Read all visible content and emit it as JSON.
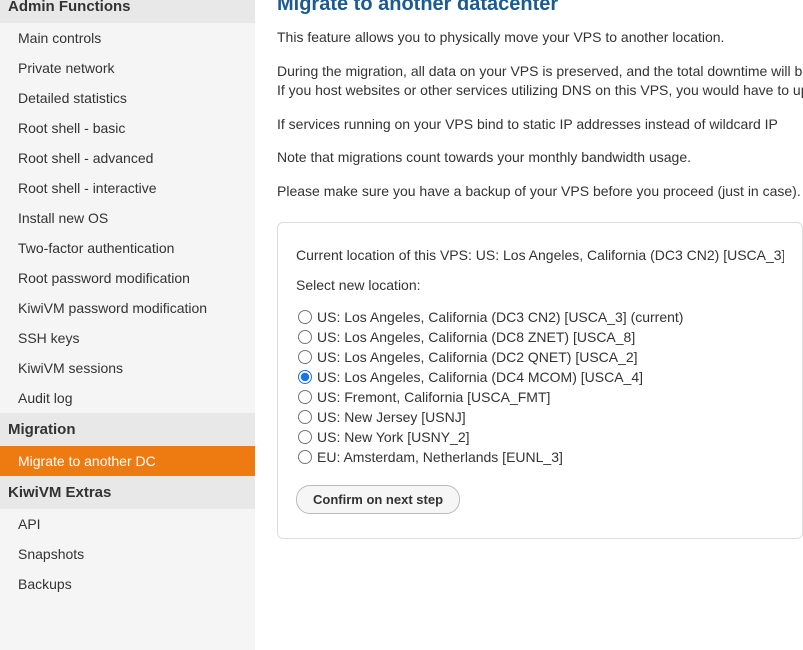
{
  "sidebar": {
    "headerTop": "Admin Functions",
    "items_top": [
      {
        "label": "Main controls"
      },
      {
        "label": "Private network"
      },
      {
        "label": "Detailed statistics"
      },
      {
        "label": "Root shell - basic"
      },
      {
        "label": "Root shell - advanced"
      },
      {
        "label": "Root shell - interactive"
      },
      {
        "label": "Install new OS"
      },
      {
        "label": "Two-factor authentication"
      },
      {
        "label": "Root password modification"
      },
      {
        "label": "KiwiVM password modification"
      },
      {
        "label": "SSH keys"
      },
      {
        "label": "KiwiVM sessions"
      },
      {
        "label": "Audit log"
      }
    ],
    "headerMigration": "Migration",
    "items_migration": [
      {
        "label": "Migrate to another DC"
      }
    ],
    "headerExtras": "KiwiVM Extras",
    "items_extras": [
      {
        "label": "API"
      },
      {
        "label": "Snapshots"
      },
      {
        "label": "Backups"
      }
    ]
  },
  "main": {
    "title": "Migrate to another datacenter",
    "p1": "This feature allows you to physically move your VPS to another location.",
    "p2a": "During the migration, all data on your VPS is preserved, and the total downtime will be",
    "p2b": "If you host websites or other services utilizing DNS on this VPS, you would have to update",
    "p3": "If services running on your VPS bind to static IP addresses instead of wildcard IP",
    "p4": "Note that migrations count towards your monthly bandwidth usage.",
    "p5": "Please make sure you have a backup of your VPS before you proceed (just in case).",
    "currentLabel": "Current location of this VPS: ",
    "currentValue": "US: Los Angeles, California (DC3 CN2) [USCA_3]",
    "selectLabel": "Select new location:",
    "options": [
      {
        "label": "US: Los Angeles, California (DC3 CN2) [USCA_3] (current)"
      },
      {
        "label": "US: Los Angeles, California (DC8 ZNET) [USCA_8]"
      },
      {
        "label": "US: Los Angeles, California (DC2 QNET) [USCA_2]"
      },
      {
        "label": "US: Los Angeles, California (DC4 MCOM) [USCA_4]"
      },
      {
        "label": "US: Fremont, California [USCA_FMT]"
      },
      {
        "label": "US: New Jersey [USNJ]"
      },
      {
        "label": "US: New York [USNY_2]"
      },
      {
        "label": "EU: Amsterdam, Netherlands [EUNL_3]"
      }
    ],
    "selectedIndex": 3,
    "confirmLabel": "Confirm on next step"
  }
}
